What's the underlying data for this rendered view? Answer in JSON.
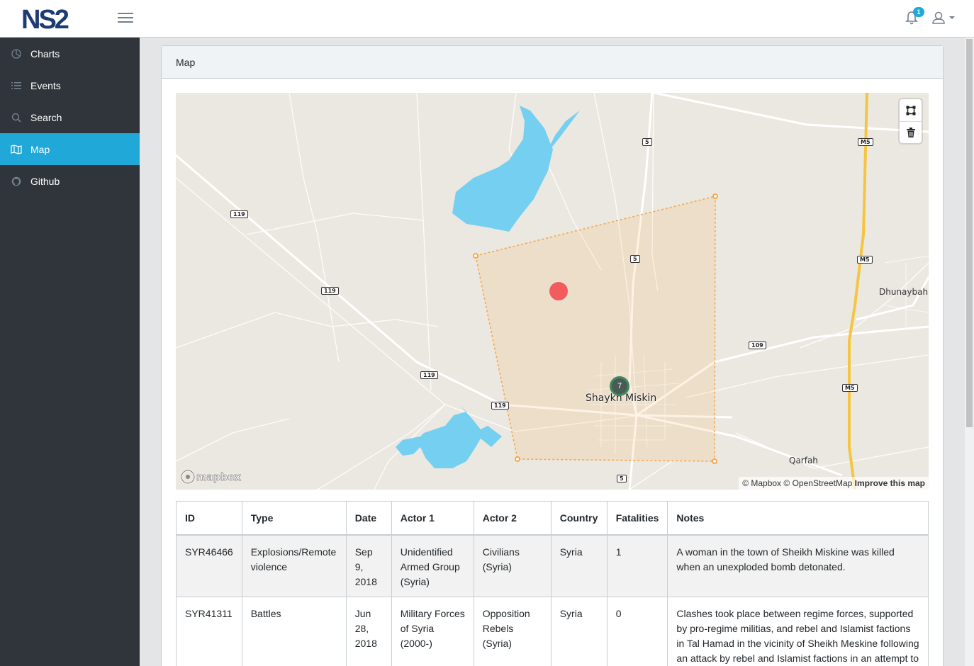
{
  "header": {
    "logo_text": "NS2",
    "notifications_count": "1",
    "icons": [
      "menu-icon",
      "bell-icon",
      "user-icon",
      "caret-down-icon"
    ]
  },
  "sidebar": {
    "items": [
      {
        "label": "Charts",
        "icon": "pie-chart-icon",
        "active": false
      },
      {
        "label": "Events",
        "icon": "list-icon",
        "active": false
      },
      {
        "label": "Search",
        "icon": "search-icon",
        "active": false
      },
      {
        "label": "Map",
        "icon": "map-icon",
        "active": true
      },
      {
        "label": "Github",
        "icon": "github-icon",
        "active": false
      }
    ]
  },
  "card": {
    "title": "Map"
  },
  "map": {
    "attribution": {
      "mapbox": "© Mapbox",
      "osm": "© OpenStreetMap",
      "improve": "Improve this map"
    },
    "logo_text": "mapbox",
    "controls": [
      "polygon-draw-icon",
      "trash-icon"
    ],
    "road_labels": [
      "5",
      "5",
      "5",
      "M5",
      "M5",
      "M5",
      "119",
      "119",
      "119",
      "119",
      "109"
    ],
    "place_labels": {
      "city": "Shaykh Miskin",
      "p1": "Dhunaybah",
      "p2": "Qarfah"
    },
    "cluster_count": "7",
    "colors": {
      "water": "#75cff0",
      "land": "#ebe8e1",
      "highway": "#f5c542",
      "selection": "#f7a74a",
      "event": "#f25c5c",
      "cluster": "#4a5a55"
    }
  },
  "table": {
    "columns": [
      "ID",
      "Type",
      "Date",
      "Actor 1",
      "Actor 2",
      "Country",
      "Fatalities",
      "Notes"
    ],
    "rows": [
      [
        "SYR46466",
        "Explosions/Remote violence",
        "Sep 9, 2018",
        "Unidentified Armed Group (Syria)",
        "Civilians (Syria)",
        "Syria",
        "1",
        "A woman in the town of Sheikh Miskine was killed when an unexploded bomb detonated."
      ],
      [
        "SYR41311",
        "Battles",
        "Jun 28, 2018",
        "Military Forces of Syria (2000-)",
        "Opposition Rebels (Syria)",
        "Syria",
        "0",
        "Clashes took place between regime forces, supported by pro-regime militias, and rebel and Islamist factions in Tal Hamad in the vicinity of Sheikh Meskine following an attack by rebel and Islamist factions in an attempt to"
      ]
    ]
  },
  "theme": {
    "sidebar_bg": "#2f353a",
    "active_bg": "#20a8d8",
    "brand": "#1f3b73"
  }
}
